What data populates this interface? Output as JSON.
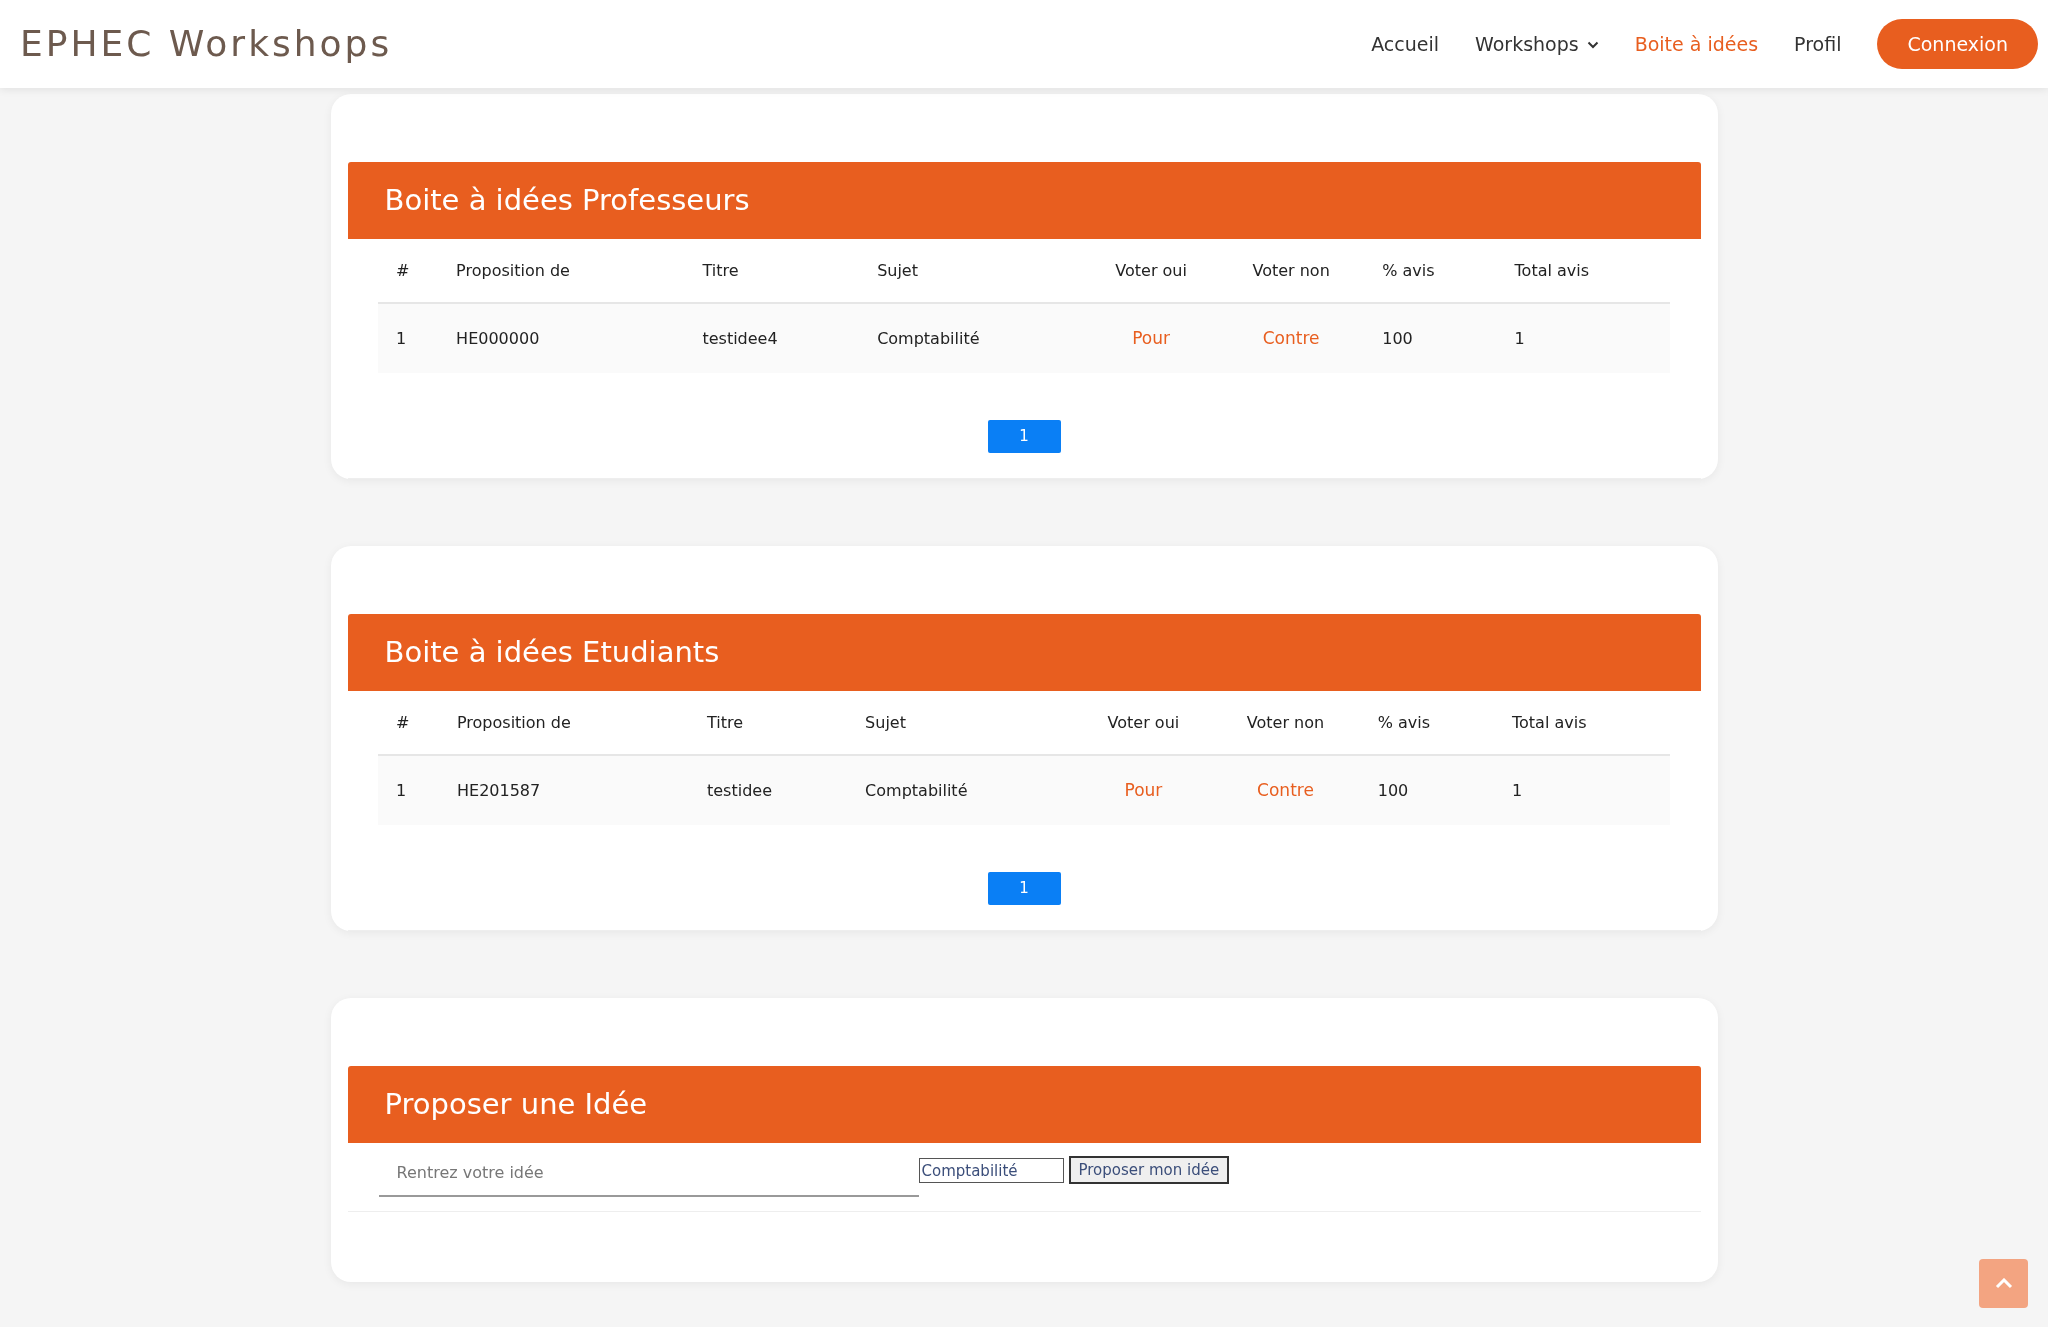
{
  "navbar": {
    "brand": "EPHEC Workshops",
    "items": [
      {
        "label": "Accueil",
        "kind": "link",
        "selected": false
      },
      {
        "label": "Workshops",
        "kind": "dropdown",
        "selected": false
      },
      {
        "label": "Boite à idées",
        "kind": "link",
        "selected": true
      },
      {
        "label": "Profil",
        "kind": "link",
        "selected": false
      }
    ],
    "login_button": "Connexion"
  },
  "idea_boxes": [
    {
      "title": "Boite à idées Professeurs",
      "columns": [
        "#",
        "Proposition de",
        "Titre",
        "Sujet",
        "Voter oui",
        "Voter non",
        "% avis",
        "Total avis"
      ],
      "rows": [
        {
          "number": "1",
          "proposer": "HE000000",
          "title": "testidee4",
          "subject": "Comptabilité",
          "vote_yes": "Pour",
          "vote_no": "Contre",
          "percent": "100",
          "total": "1"
        }
      ],
      "pages": [
        {
          "label": "1",
          "selected": true
        }
      ]
    },
    {
      "title": "Boite à idées Etudiants",
      "columns": [
        "#",
        "Proposition de",
        "Titre",
        "Sujet",
        "Voter oui",
        "Voter non",
        "% avis",
        "Total avis"
      ],
      "rows": [
        {
          "number": "1",
          "proposer": "HE201587",
          "title": "testidee",
          "subject": "Comptabilité",
          "vote_yes": "Pour",
          "vote_no": "Contre",
          "percent": "100",
          "total": "1"
        }
      ],
      "pages": [
        {
          "label": "1",
          "selected": true
        }
      ]
    }
  ],
  "propose_form": {
    "title": "Proposer une Idée",
    "idea_field": {
      "placeholder": "Rentrez votre idée"
    },
    "subject_field": {
      "value": "Comptabilité"
    },
    "submit_button": "Proposer mon idée"
  }
}
